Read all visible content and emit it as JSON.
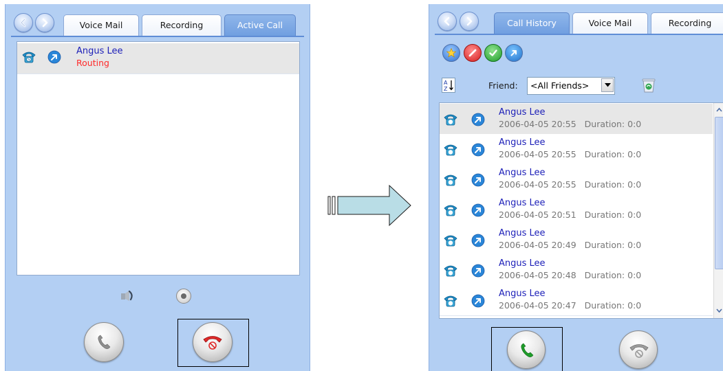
{
  "left_panel": {
    "tabs": [
      {
        "label": "Voice Mail",
        "active": false
      },
      {
        "label": "Recording",
        "active": false
      },
      {
        "label": "Active Call",
        "active": true
      }
    ],
    "active_call": {
      "name": "Angus Lee",
      "status": "Routing",
      "status_color": "#ff2a2a"
    },
    "controls": {
      "transfer_icon": "call-forward-icon",
      "record_icon": "record-dot-icon",
      "answer_icon": "handset-gray-icon",
      "hangup_icon": "handset-red-hangup-icon"
    }
  },
  "right_panel": {
    "tabs": [
      {
        "label": "Call History",
        "active": true
      },
      {
        "label": "Voice Mail",
        "active": false
      },
      {
        "label": "Recording",
        "active": false
      }
    ],
    "toolbar_icons": [
      "star-icon",
      "no-entry-icon",
      "check-icon",
      "outgoing-arrow-icon"
    ],
    "sort_icon": "az-sort-icon",
    "friend_filter": {
      "label": "Friend:",
      "selected": "<All Friends>"
    },
    "delete_icon": "recycle-bin-icon",
    "history": [
      {
        "name": "Angus Lee",
        "datetime": "2006-04-05 20:55",
        "duration": "Duration: 0:0"
      },
      {
        "name": "Angus Lee",
        "datetime": "2006-04-05 20:55",
        "duration": "Duration: 0:0"
      },
      {
        "name": "Angus Lee",
        "datetime": "2006-04-05 20:55",
        "duration": "Duration: 0:0"
      },
      {
        "name": "Angus Lee",
        "datetime": "2006-04-05 20:51",
        "duration": "Duration: 0:0"
      },
      {
        "name": "Angus Lee",
        "datetime": "2006-04-05 20:49",
        "duration": "Duration: 0:0"
      },
      {
        "name": "Angus Lee",
        "datetime": "2006-04-05 20:48",
        "duration": "Duration: 0:0"
      },
      {
        "name": "Angus Lee",
        "datetime": "2006-04-05 20:47",
        "duration": "Duration: 0:0"
      }
    ],
    "controls": {
      "call_icon": "handset-green-icon",
      "hangup_icon": "handset-gray-hangup-icon"
    }
  },
  "colors": {
    "panel_bg": "#b3cff3",
    "active_tab": "#7aa6e6",
    "name_text": "#1c1fb8",
    "meta_text": "#777777",
    "arrow_fill": "#b9dde6"
  }
}
